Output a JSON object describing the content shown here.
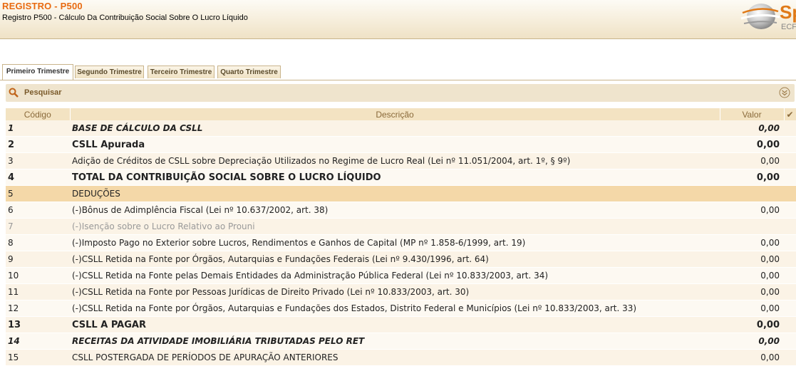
{
  "header": {
    "title": "REGISTRO - P500",
    "subtitle": "Registro P500 - Cálculo Da Contribuição Social Sobre O Lucro Líquido",
    "logo_text": "Sp",
    "logo_sub": "ECF"
  },
  "tabs": [
    {
      "label": "Primeiro Trimestre",
      "active": true
    },
    {
      "label": "Segundo Trimestre",
      "active": false
    },
    {
      "label": "Terceiro Trimestre",
      "active": false
    },
    {
      "label": "Quarto Trimestre",
      "active": false
    }
  ],
  "search": {
    "label": "Pesquisar",
    "icon": "search-icon",
    "expand_icon": "chevron-double-down-icon"
  },
  "table": {
    "columns": [
      "Código",
      "Descrição",
      "Valor"
    ],
    "check_icon": "checkmark-icon",
    "rows": [
      {
        "code": "1",
        "desc": "BASE DE CÁLCULO DA CSLL",
        "value": "0,00",
        "style": "bold-it"
      },
      {
        "code": "2",
        "desc": "CSLL Apurada",
        "value": "0,00",
        "style": "bold-big"
      },
      {
        "code": "3",
        "desc": "Adição de Créditos de CSLL sobre Depreciação Utilizados no Regime de Lucro Real (Lei nº 11.051/2004, art. 1º, § 9º)",
        "value": "0,00",
        "style": ""
      },
      {
        "code": "4",
        "desc": "TOTAL DA CONTRIBUIÇÃO SOCIAL SOBRE O LUCRO LÍQUIDO",
        "value": "0,00",
        "style": "bold-big"
      },
      {
        "code": "5",
        "desc": "DEDUÇÕES",
        "value": "",
        "style": "hl"
      },
      {
        "code": "6",
        "desc": "(-)Bônus de Adimplência Fiscal (Lei nº 10.637/2002, art. 38)",
        "value": "0,00",
        "style": ""
      },
      {
        "code": "7",
        "desc": "(-)Isenção sobre o Lucro Relativo ao Prouni",
        "value": "",
        "style": "grey"
      },
      {
        "code": "8",
        "desc": "(-)Imposto Pago no Exterior sobre Lucros, Rendimentos e Ganhos de Capital (MP nº 1.858-6/1999, art. 19)",
        "value": "0,00",
        "style": ""
      },
      {
        "code": "9",
        "desc": "(-)CSLL Retida na Fonte por Órgãos, Autarquias e Fundações Federais (Lei nº 9.430/1996, art. 64)",
        "value": "0,00",
        "style": ""
      },
      {
        "code": "10",
        "desc": "(-)CSLL Retida na Fonte pelas Demais Entidades da Administração Pública Federal (Lei nº 10.833/2003, art. 34)",
        "value": "0,00",
        "style": ""
      },
      {
        "code": "11",
        "desc": "(-)CSLL Retida na Fonte por Pessoas Jurídicas de Direito Privado (Lei nº 10.833/2003, art. 30)",
        "value": "0,00",
        "style": ""
      },
      {
        "code": "12",
        "desc": "(-)CSLL Retida na Fonte por Órgãos, Autarquias e Fundações dos Estados, Distrito Federal e Municípios (Lei nº 10.833/2003, art. 33)",
        "value": "0,00",
        "style": ""
      },
      {
        "code": "13",
        "desc": "CSLL A PAGAR",
        "value": "0,00",
        "style": "bold-big"
      },
      {
        "code": "14",
        "desc": "RECEITAS DA ATIVIDADE IMOBILIÁRIA TRIBUTADAS PELO RET",
        "value": "0,00",
        "style": "bold-it"
      },
      {
        "code": "15",
        "desc": "CSLL POSTERGADA DE PERÍODOS DE APURAÇÃO ANTERIORES",
        "value": "0,00",
        "style": ""
      }
    ]
  }
}
